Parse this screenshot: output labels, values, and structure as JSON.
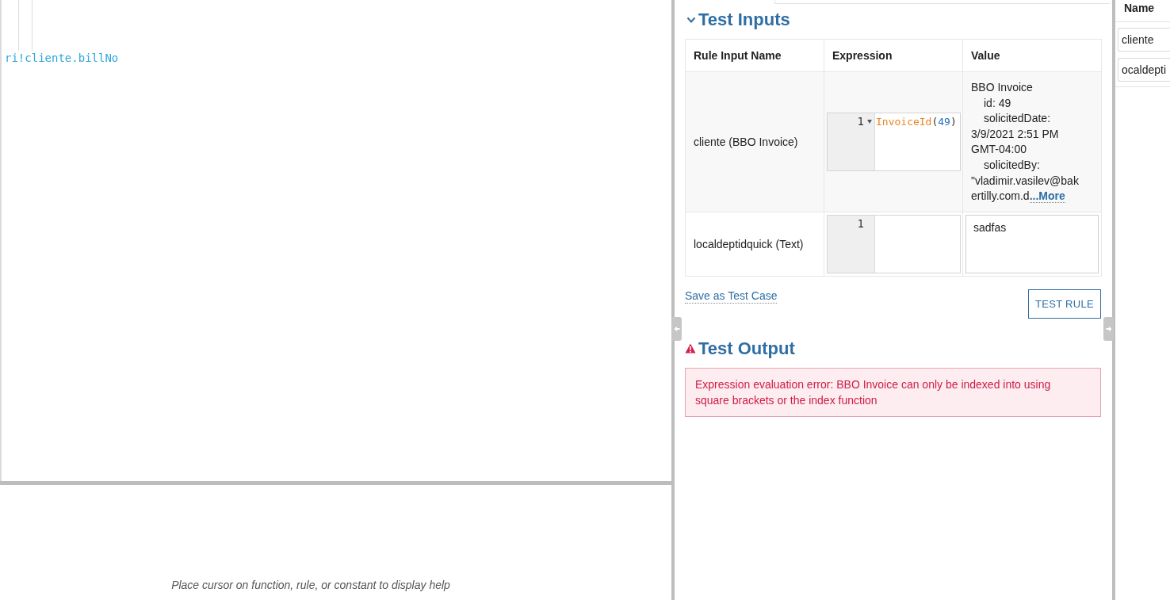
{
  "expression_editor": {
    "code": "ri!cliente.billNo"
  },
  "help_panel": {
    "message": "Place cursor on function, rule, or constant to display help"
  },
  "test_inputs": {
    "title": "Test Inputs",
    "expanded": true,
    "columns": [
      "Rule Input Name",
      "Expression",
      "Value"
    ],
    "rows": [
      {
        "name": "cliente (BBO Invoice)",
        "expression": {
          "line_number": "1",
          "foldable": true,
          "tokens": [
            {
              "kind": "function",
              "text": "InvoiceId"
            },
            {
              "kind": "punct",
              "text": "("
            },
            {
              "kind": "number",
              "text": "49"
            },
            {
              "kind": "punct",
              "text": ")"
            }
          ]
        },
        "value": {
          "kind": "preview",
          "heading": "BBO Invoice",
          "fields": [
            "id: 49",
            "solicitedDate: 3/9/2021 2:51 PM GMT-04:00",
            "solicitedBy: \"vladimir.vasilev@bakertilly.com.d"
          ],
          "more_link": "...More"
        }
      },
      {
        "name": "localdeptidquick (Text)",
        "expression": {
          "line_number": "1",
          "foldable": false
        },
        "value": {
          "kind": "field",
          "text": "sadfas"
        }
      }
    ],
    "save_link": "Save as Test Case",
    "test_button": "TEST RULE"
  },
  "test_output": {
    "title": "Test Output",
    "kind": "error",
    "message": "Expression evaluation error: BBO Invoice can only be indexed into using square brackets or the index function"
  },
  "rule_inputs_panel": {
    "column": "Name",
    "inputs": [
      "cliente",
      "ocaldepti"
    ]
  }
}
